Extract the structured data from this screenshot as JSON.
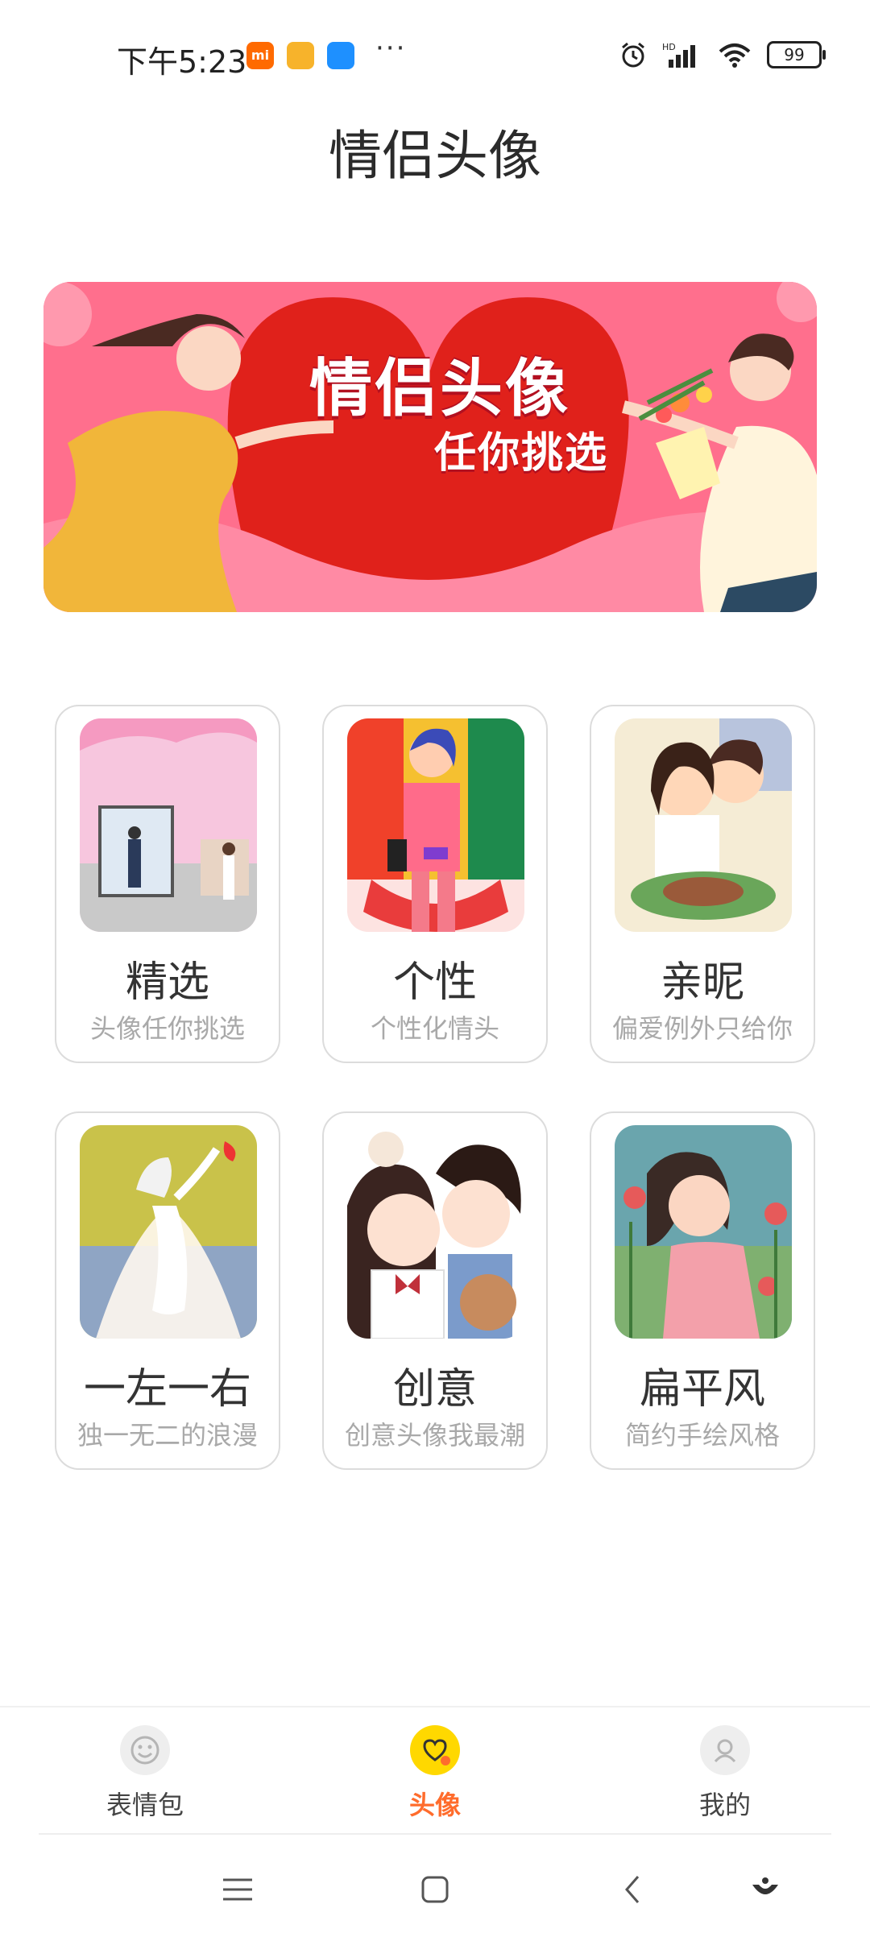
{
  "status_bar": {
    "time": "下午5:23",
    "battery": "99"
  },
  "title": "情侣头像",
  "banner": {
    "title": "情侣头像",
    "subtitle": "任你挑选"
  },
  "categories": [
    {
      "name": "精选",
      "desc": "头像任你挑选"
    },
    {
      "name": "个性",
      "desc": "个性化情头"
    },
    {
      "name": "亲昵",
      "desc": "偏爱例外只给你"
    },
    {
      "name": "一左一右",
      "desc": "独一无二的浪漫"
    },
    {
      "name": "创意",
      "desc": "创意头像我最潮"
    },
    {
      "name": "扁平风",
      "desc": "简约手绘风格"
    }
  ],
  "bottom_nav": [
    {
      "label": "表情包",
      "icon": "smiley-icon"
    },
    {
      "label": "头像",
      "icon": "heart-chat-icon",
      "active": true
    },
    {
      "label": "我的",
      "icon": "user-icon"
    }
  ],
  "colors": {
    "accent": "#ff6c2c",
    "active_nav_bg": "#ffd800",
    "banner_bg": "#ff6f8d",
    "banner_heart": "#e0211b"
  }
}
